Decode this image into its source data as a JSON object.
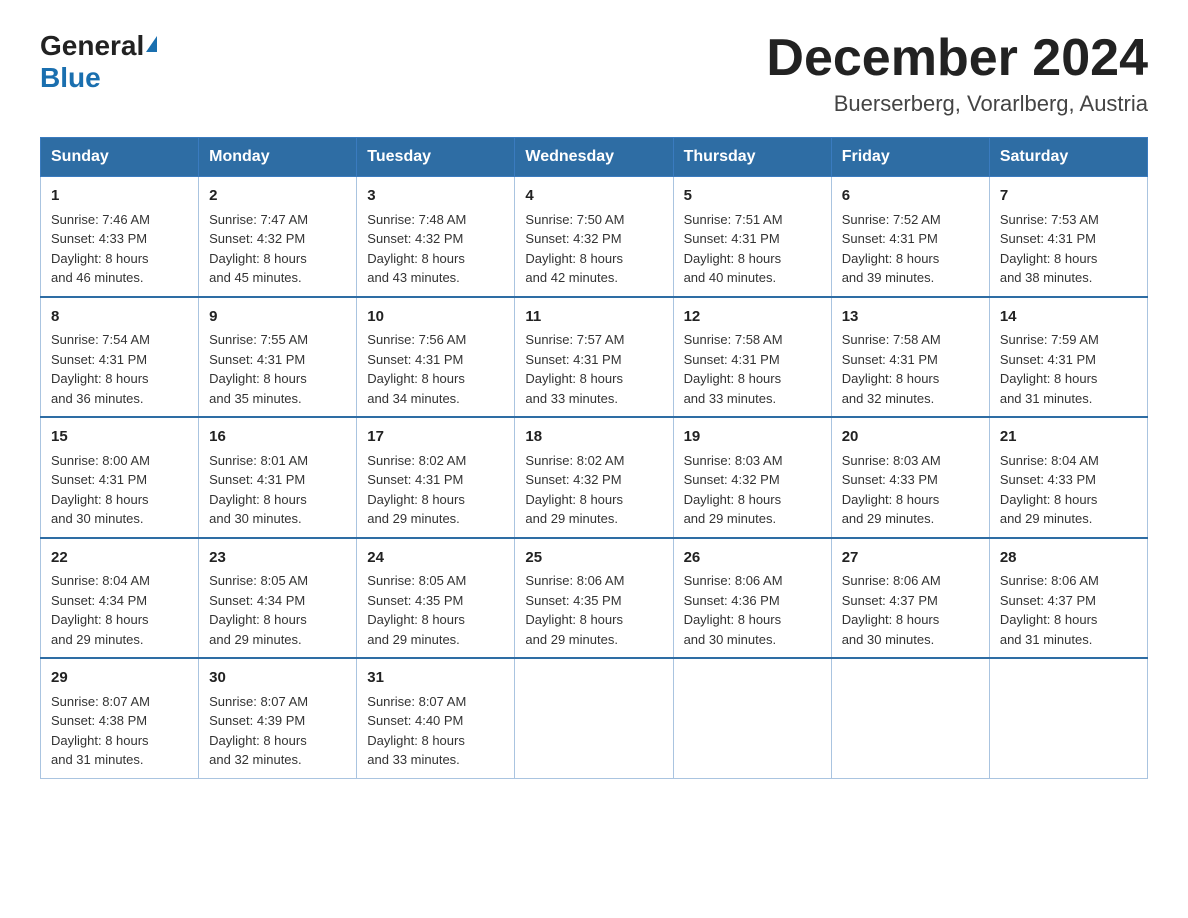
{
  "header": {
    "logo_general": "General",
    "logo_blue": "Blue",
    "title": "December 2024",
    "subtitle": "Buerserberg, Vorarlberg, Austria"
  },
  "weekdays": [
    "Sunday",
    "Monday",
    "Tuesday",
    "Wednesday",
    "Thursday",
    "Friday",
    "Saturday"
  ],
  "weeks": [
    [
      {
        "day": "1",
        "sunrise": "7:46 AM",
        "sunset": "4:33 PM",
        "daylight": "8 hours and 46 minutes."
      },
      {
        "day": "2",
        "sunrise": "7:47 AM",
        "sunset": "4:32 PM",
        "daylight": "8 hours and 45 minutes."
      },
      {
        "day": "3",
        "sunrise": "7:48 AM",
        "sunset": "4:32 PM",
        "daylight": "8 hours and 43 minutes."
      },
      {
        "day": "4",
        "sunrise": "7:50 AM",
        "sunset": "4:32 PM",
        "daylight": "8 hours and 42 minutes."
      },
      {
        "day": "5",
        "sunrise": "7:51 AM",
        "sunset": "4:31 PM",
        "daylight": "8 hours and 40 minutes."
      },
      {
        "day": "6",
        "sunrise": "7:52 AM",
        "sunset": "4:31 PM",
        "daylight": "8 hours and 39 minutes."
      },
      {
        "day": "7",
        "sunrise": "7:53 AM",
        "sunset": "4:31 PM",
        "daylight": "8 hours and 38 minutes."
      }
    ],
    [
      {
        "day": "8",
        "sunrise": "7:54 AM",
        "sunset": "4:31 PM",
        "daylight": "8 hours and 36 minutes."
      },
      {
        "day": "9",
        "sunrise": "7:55 AM",
        "sunset": "4:31 PM",
        "daylight": "8 hours and 35 minutes."
      },
      {
        "day": "10",
        "sunrise": "7:56 AM",
        "sunset": "4:31 PM",
        "daylight": "8 hours and 34 minutes."
      },
      {
        "day": "11",
        "sunrise": "7:57 AM",
        "sunset": "4:31 PM",
        "daylight": "8 hours and 33 minutes."
      },
      {
        "day": "12",
        "sunrise": "7:58 AM",
        "sunset": "4:31 PM",
        "daylight": "8 hours and 33 minutes."
      },
      {
        "day": "13",
        "sunrise": "7:58 AM",
        "sunset": "4:31 PM",
        "daylight": "8 hours and 32 minutes."
      },
      {
        "day": "14",
        "sunrise": "7:59 AM",
        "sunset": "4:31 PM",
        "daylight": "8 hours and 31 minutes."
      }
    ],
    [
      {
        "day": "15",
        "sunrise": "8:00 AM",
        "sunset": "4:31 PM",
        "daylight": "8 hours and 30 minutes."
      },
      {
        "day": "16",
        "sunrise": "8:01 AM",
        "sunset": "4:31 PM",
        "daylight": "8 hours and 30 minutes."
      },
      {
        "day": "17",
        "sunrise": "8:02 AM",
        "sunset": "4:31 PM",
        "daylight": "8 hours and 29 minutes."
      },
      {
        "day": "18",
        "sunrise": "8:02 AM",
        "sunset": "4:32 PM",
        "daylight": "8 hours and 29 minutes."
      },
      {
        "day": "19",
        "sunrise": "8:03 AM",
        "sunset": "4:32 PM",
        "daylight": "8 hours and 29 minutes."
      },
      {
        "day": "20",
        "sunrise": "8:03 AM",
        "sunset": "4:33 PM",
        "daylight": "8 hours and 29 minutes."
      },
      {
        "day": "21",
        "sunrise": "8:04 AM",
        "sunset": "4:33 PM",
        "daylight": "8 hours and 29 minutes."
      }
    ],
    [
      {
        "day": "22",
        "sunrise": "8:04 AM",
        "sunset": "4:34 PM",
        "daylight": "8 hours and 29 minutes."
      },
      {
        "day": "23",
        "sunrise": "8:05 AM",
        "sunset": "4:34 PM",
        "daylight": "8 hours and 29 minutes."
      },
      {
        "day": "24",
        "sunrise": "8:05 AM",
        "sunset": "4:35 PM",
        "daylight": "8 hours and 29 minutes."
      },
      {
        "day": "25",
        "sunrise": "8:06 AM",
        "sunset": "4:35 PM",
        "daylight": "8 hours and 29 minutes."
      },
      {
        "day": "26",
        "sunrise": "8:06 AM",
        "sunset": "4:36 PM",
        "daylight": "8 hours and 30 minutes."
      },
      {
        "day": "27",
        "sunrise": "8:06 AM",
        "sunset": "4:37 PM",
        "daylight": "8 hours and 30 minutes."
      },
      {
        "day": "28",
        "sunrise": "8:06 AM",
        "sunset": "4:37 PM",
        "daylight": "8 hours and 31 minutes."
      }
    ],
    [
      {
        "day": "29",
        "sunrise": "8:07 AM",
        "sunset": "4:38 PM",
        "daylight": "8 hours and 31 minutes."
      },
      {
        "day": "30",
        "sunrise": "8:07 AM",
        "sunset": "4:39 PM",
        "daylight": "8 hours and 32 minutes."
      },
      {
        "day": "31",
        "sunrise": "8:07 AM",
        "sunset": "4:40 PM",
        "daylight": "8 hours and 33 minutes."
      },
      null,
      null,
      null,
      null
    ]
  ],
  "labels": {
    "sunrise": "Sunrise:",
    "sunset": "Sunset:",
    "daylight": "Daylight:"
  }
}
